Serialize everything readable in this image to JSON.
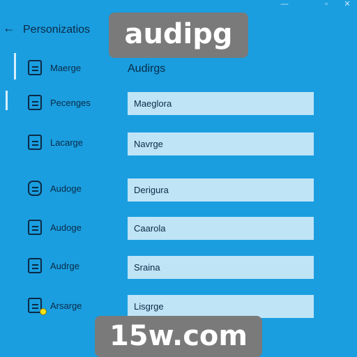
{
  "window": {
    "controls": [
      {
        "name": "minimize-button",
        "glyph": "—"
      },
      {
        "name": "maximize-button",
        "glyph": "▫"
      },
      {
        "name": "close-button",
        "glyph": "✕"
      }
    ]
  },
  "header": {
    "back_glyph": "←",
    "title": "Personizatios"
  },
  "overlays": {
    "top": "audipg",
    "bottom": "15w.com"
  },
  "sidebar": {
    "items": [
      {
        "label": "Maerge",
        "icon": "document-icon"
      },
      {
        "label": "Pecenges",
        "icon": "document-icon"
      },
      {
        "label": "Lacarge",
        "icon": "document-icon"
      },
      {
        "label": "Audoge",
        "icon": "audio-icon"
      },
      {
        "label": "Audoge",
        "icon": "document-icon"
      },
      {
        "label": "Audrge",
        "icon": "document-icon"
      },
      {
        "label": "Arsarge",
        "icon": "document-icon"
      }
    ]
  },
  "main": {
    "heading": "Audirgs",
    "fields": [
      "Maeglora",
      "Navrge",
      "Derigura",
      "Caarola",
      "Sraina",
      "Lisgrge"
    ]
  }
}
